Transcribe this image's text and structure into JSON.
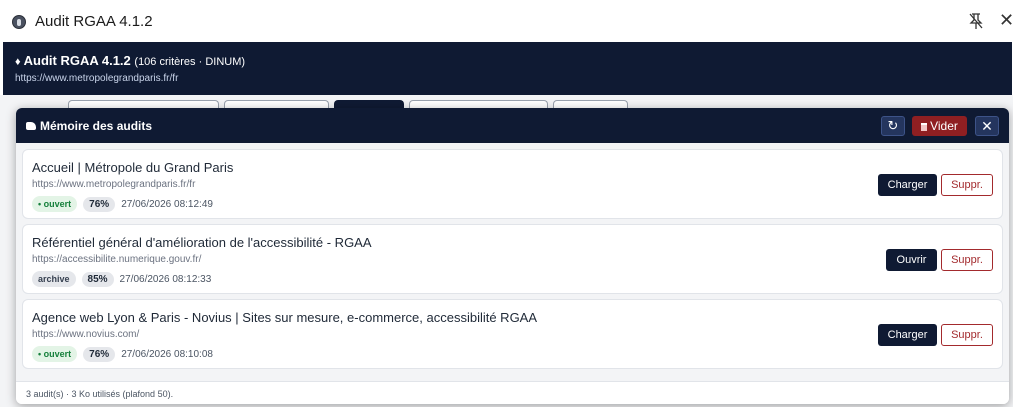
{
  "window": {
    "title": "Audit RGAA 4.1.2"
  },
  "header": {
    "title": "Audit RGAA 4.1.2",
    "subtitle": "(106 critères · DINUM)",
    "url": "https://www.metropolegrandparis.fr/fr"
  },
  "modal": {
    "title": "Mémoire des audits",
    "refresh_label": "↻",
    "clear_label": "Vider",
    "close_label": "✕",
    "footer": "3 audit(s) · 3 Ko utilisés (plafond 50)."
  },
  "audits": [
    {
      "title": "Accueil | Métropole du Grand Paris",
      "url": "https://www.metropolegrandparis.fr/fr",
      "status": "• ouvert",
      "score": "76%",
      "date": "27/06/2026 08:12:49",
      "action": "Charger",
      "delete": "Suppr."
    },
    {
      "title": "Référentiel général d'amélioration de l'accessibilité - RGAA",
      "url": "https://accessibilite.numerique.gouv.fr/",
      "status": "archive",
      "score": "85%",
      "date": "27/06/2026 08:12:33",
      "action": "Ouvrir",
      "delete": "Suppr."
    },
    {
      "title": "Agence web Lyon & Paris - Novius | Sites sur mesure, e-commerce, accessibilité RGAA",
      "url": "https://www.novius.com/",
      "status": "• ouvert",
      "score": "76%",
      "date": "27/06/2026 08:10:08",
      "action": "Charger",
      "delete": "Suppr."
    }
  ],
  "colors": {
    "navy": "#0f1a33",
    "danger": "#8f1f22",
    "open_green": "#16803c"
  }
}
